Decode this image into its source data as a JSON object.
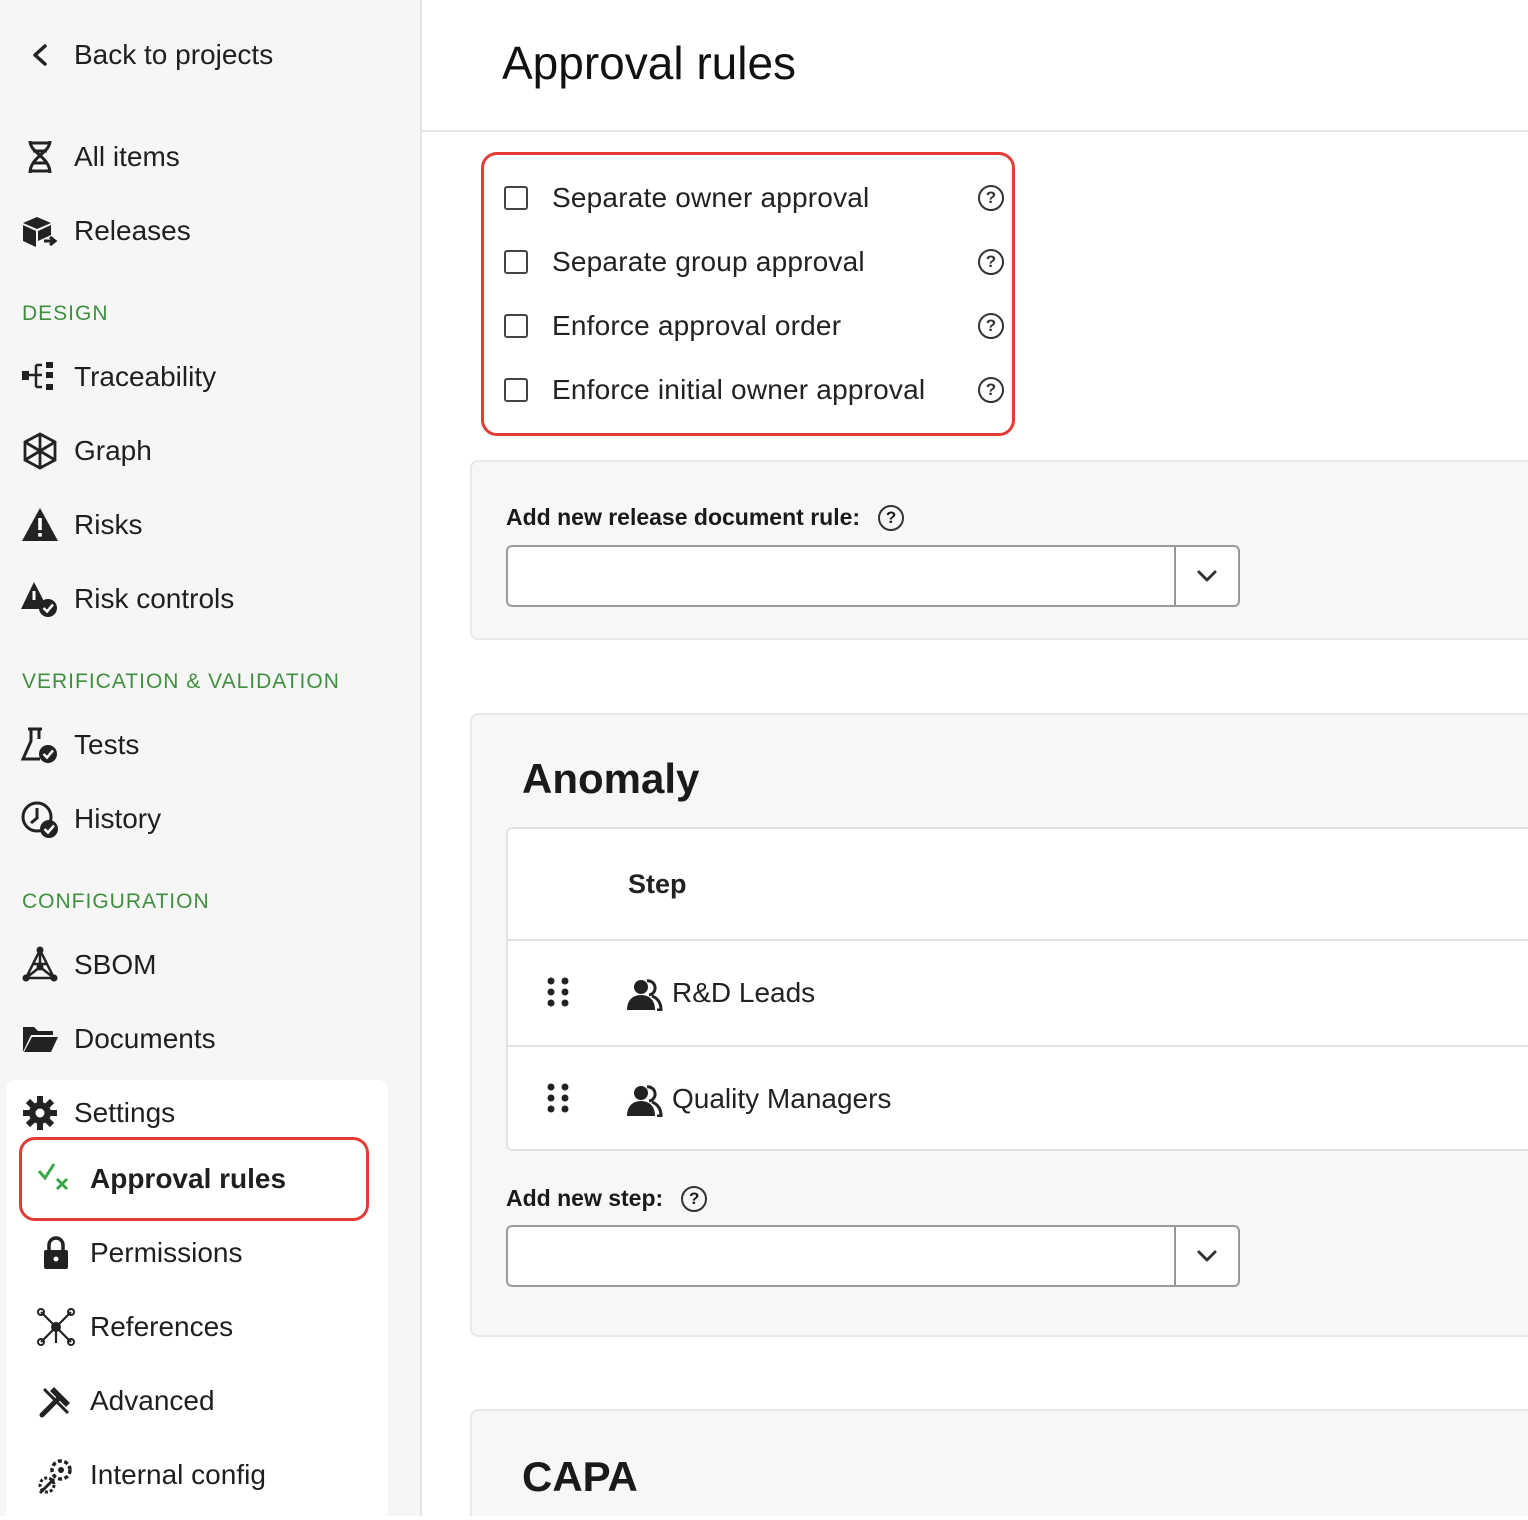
{
  "sidebar": {
    "back": "Back to projects",
    "top_items": [
      {
        "label": "All items",
        "icon": "dna-icon"
      },
      {
        "label": "Releases",
        "icon": "releases-icon"
      }
    ],
    "sections": {
      "design": "DESIGN",
      "vv": "VERIFICATION & VALIDATION",
      "configuration": "CONFIGURATION"
    },
    "design_items": [
      {
        "label": "Traceability",
        "icon": "traceability-icon"
      },
      {
        "label": "Graph",
        "icon": "graph-icon"
      },
      {
        "label": "Risks",
        "icon": "warning-icon"
      },
      {
        "label": "Risk controls",
        "icon": "risk-control-icon"
      }
    ],
    "vv_items": [
      {
        "label": "Tests",
        "icon": "flask-icon"
      },
      {
        "label": "History",
        "icon": "history-icon"
      }
    ],
    "config_items": [
      {
        "label": "SBOM",
        "icon": "sbom-icon"
      },
      {
        "label": "Documents",
        "icon": "folder-icon"
      },
      {
        "label": "Settings",
        "icon": "gear-icon"
      }
    ],
    "settings_items": [
      {
        "label": "Approval rules",
        "icon": "approval-icon",
        "active": true
      },
      {
        "label": "Permissions",
        "icon": "lock-icon"
      },
      {
        "label": "References",
        "icon": "references-icon"
      },
      {
        "label": "Advanced",
        "icon": "tools-icon"
      },
      {
        "label": "Internal config",
        "icon": "gears-icon"
      }
    ]
  },
  "main": {
    "title": "Approval rules",
    "options": [
      {
        "label": "Separate owner approval",
        "checked": false
      },
      {
        "label": "Separate group approval",
        "checked": false
      },
      {
        "label": "Enforce approval order",
        "checked": false
      },
      {
        "label": "Enforce initial owner approval",
        "checked": false
      }
    ],
    "release_rule": {
      "label": "Add new release document rule:",
      "value": ""
    },
    "anomaly": {
      "title": "Anomaly",
      "column": "Step",
      "steps": [
        "R&D Leads",
        "Quality Managers"
      ],
      "add_step_label": "Add new step:",
      "add_step_value": ""
    },
    "capa": {
      "title": "CAPA"
    }
  },
  "colors": {
    "section_label": "#3f8f3f",
    "highlight": "#e33b35",
    "approval_icon": "#3aa84a"
  }
}
